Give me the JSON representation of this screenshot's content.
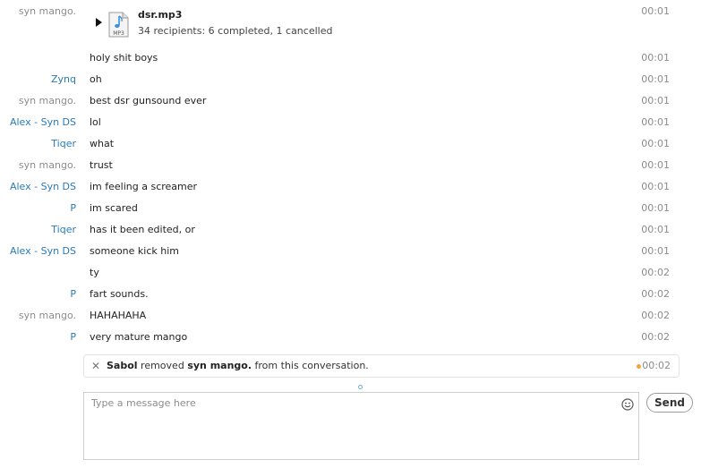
{
  "colors": {
    "sender_self": "#8c8c8c",
    "sender_other": "#2a7ab8",
    "event_dot": "#f2a53a"
  },
  "file_transfer": {
    "sender": "syn mango.",
    "file_name": "dsr.mp3",
    "file_icon_label": "MP3",
    "status": "34 recipients: 6 completed, 1 cancelled",
    "time": "00:01"
  },
  "messages": [
    {
      "sender": "",
      "text": "holy shit boys",
      "time": "00:01"
    },
    {
      "sender": "Zynq",
      "text": "oh",
      "time": "00:01"
    },
    {
      "sender": "syn mango.",
      "text": "best dsr gunsound ever",
      "time": "00:01"
    },
    {
      "sender": "Alex - Syn DS",
      "text": "lol",
      "time": "00:01"
    },
    {
      "sender": "Tiqer",
      "text": "what",
      "time": "00:01"
    },
    {
      "sender": "syn mango.",
      "text": "trust",
      "time": "00:01"
    },
    {
      "sender": "Alex - Syn DS",
      "text": "im feeling a screamer",
      "time": "00:01"
    },
    {
      "sender": "P",
      "text": "im scared",
      "time": "00:01"
    },
    {
      "sender": "Tiqer",
      "text": "has it been edited, or",
      "time": "00:01"
    },
    {
      "sender": "Alex - Syn DS",
      "text": "someone kick him",
      "time": "00:01"
    },
    {
      "sender": "",
      "text": "ty",
      "time": "00:02"
    },
    {
      "sender": "P",
      "text": "fart sounds.",
      "time": "00:02"
    },
    {
      "sender": "syn mango.",
      "text": "HAHAHAHA",
      "time": "00:02"
    },
    {
      "sender": "P",
      "text": "very mature mango",
      "time": "00:02"
    }
  ],
  "event": {
    "actor": "Sabol",
    "action": "removed",
    "target": "syn mango.",
    "suffix": "from this conversation.",
    "time": "00:02"
  },
  "composer": {
    "placeholder": "Type a message here",
    "send_label": "Send"
  }
}
